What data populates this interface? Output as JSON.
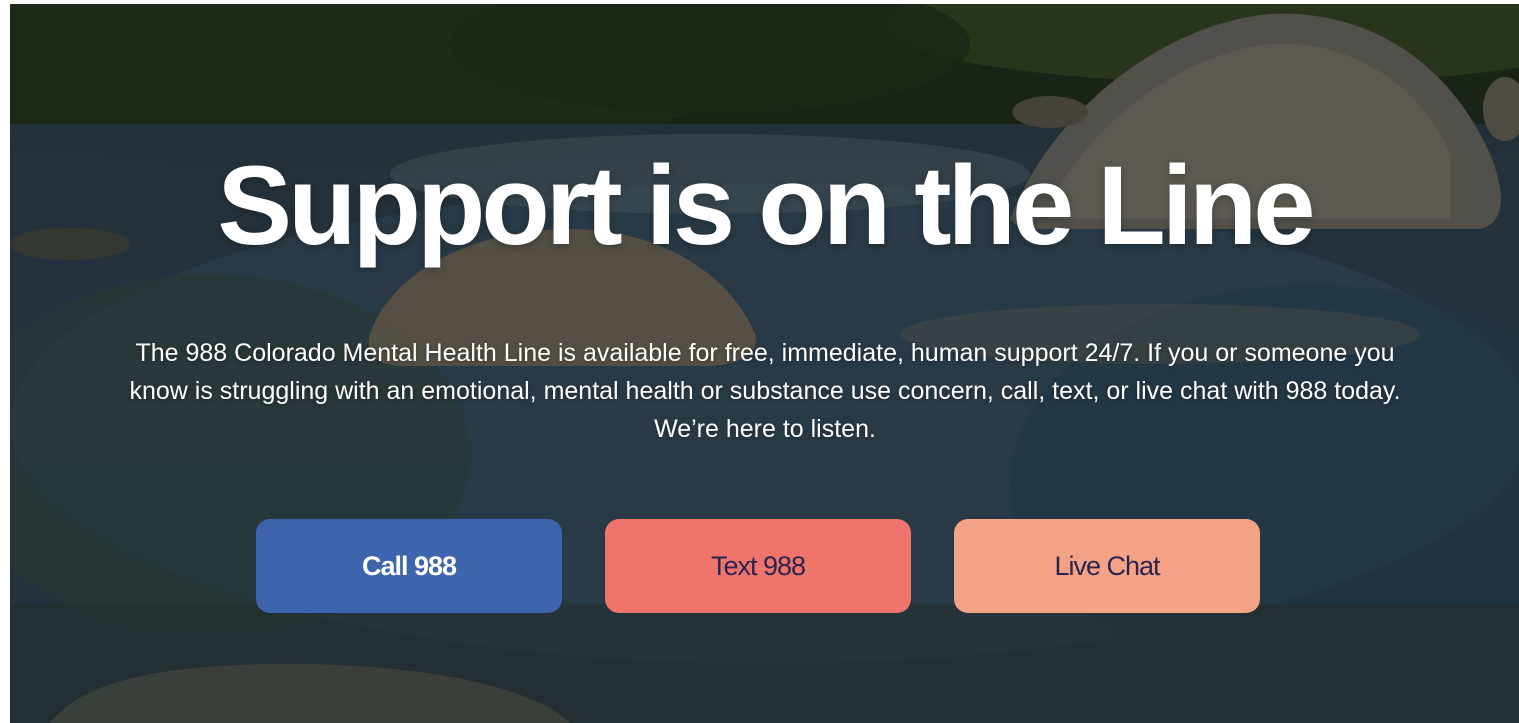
{
  "hero": {
    "headline": "Support is on the Line",
    "body": "The 988 Colorado Mental Health Line is available for free, immediate, human support 24/7. If you or someone you know is struggling with an emotional, mental health or substance use concern, call, text, or live chat with 988 today. We’re here to listen."
  },
  "actions": {
    "call_label": "Call 988",
    "text_label": "Text 988",
    "chat_label": "Live Chat"
  },
  "colors": {
    "call": "#3d64ad",
    "text": "#ef746b",
    "chat": "#f5a387",
    "button_dark_text": "#2d2450"
  }
}
